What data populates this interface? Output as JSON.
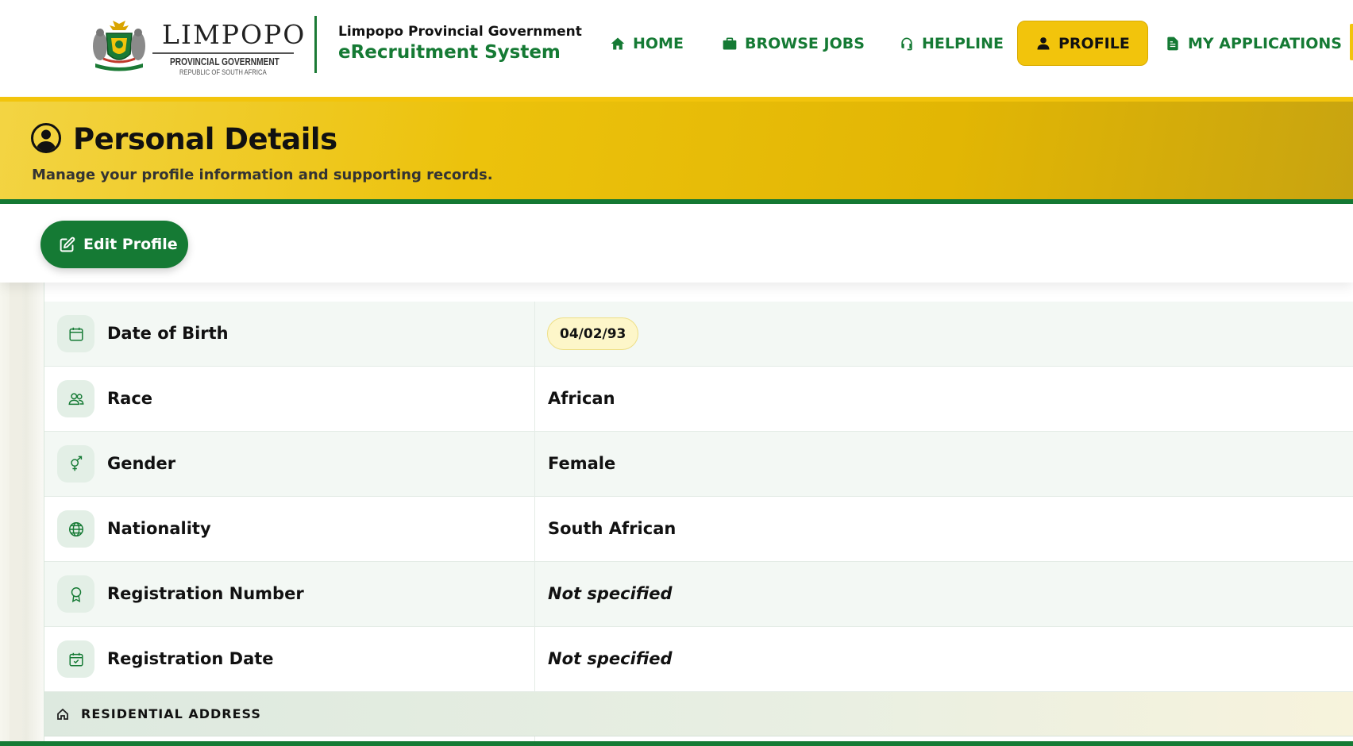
{
  "header": {
    "logo": {
      "word": "LIMPOPO",
      "line1": "PROVINCIAL GOVERNMENT",
      "line2": "REPUBLIC OF SOUTH AFRICA"
    },
    "org": "Limpopo Provincial Government",
    "system": "eRecruitment System",
    "nav": [
      {
        "label": "HOME",
        "icon": "home-icon"
      },
      {
        "label": "BROWSE JOBS",
        "icon": "briefcase-icon"
      },
      {
        "label": "HELPLINE",
        "icon": "headset-icon"
      },
      {
        "label": "PROFILE",
        "icon": "user-icon",
        "active": true
      },
      {
        "label": "MY APPLICATIONS",
        "icon": "document-icon"
      }
    ]
  },
  "banner": {
    "title": "Personal Details",
    "subtitle": "Manage your profile information and supporting records."
  },
  "toolbar": {
    "edit_label": "Edit Profile"
  },
  "details": {
    "rows": [
      {
        "label": "Date of Birth",
        "value": "04/02/93",
        "icon": "calendar-icon"
      },
      {
        "label": "Race",
        "value": "African",
        "icon": "people-icon"
      },
      {
        "label": "Gender",
        "value": "Female",
        "icon": "gender-icon"
      },
      {
        "label": "Nationality",
        "value": "South African",
        "icon": "globe-icon"
      },
      {
        "label": "Registration Number",
        "value": "Not specified",
        "icon": "award-icon"
      },
      {
        "label": "Registration Date",
        "value": "Not specified",
        "icon": "calendar-check-icon"
      }
    ],
    "section_title": "RESIDENTIAL ADDRESS"
  },
  "colors": {
    "primary_green": "#157a34",
    "accent_yellow": "#f2c40c"
  }
}
